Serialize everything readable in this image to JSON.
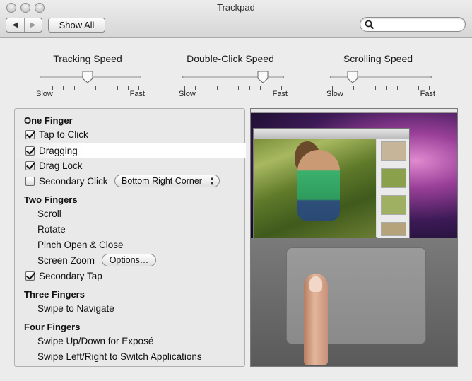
{
  "window": {
    "title": "Trackpad"
  },
  "toolbar": {
    "back_label": "◀",
    "forward_label": "▶",
    "show_all_label": "Show All",
    "search_placeholder": ""
  },
  "sliders": [
    {
      "label": "Tracking Speed",
      "min_label": "Slow",
      "max_label": "Fast",
      "value": 0.45
    },
    {
      "label": "Double-Click Speed",
      "min_label": "Slow",
      "max_label": "Fast",
      "value": 0.78
    },
    {
      "label": "Scrolling Speed",
      "min_label": "Slow",
      "max_label": "Fast",
      "value": 0.25
    }
  ],
  "sections": {
    "one_finger": {
      "title": "One Finger",
      "tap_to_click": {
        "label": "Tap to Click",
        "checked": true
      },
      "dragging": {
        "label": "Dragging",
        "checked": true
      },
      "drag_lock": {
        "label": "Drag Lock",
        "checked": true
      },
      "secondary_click": {
        "label": "Secondary Click",
        "checked": false,
        "popup_value": "Bottom Right Corner"
      }
    },
    "two_fingers": {
      "title": "Two Fingers",
      "scroll": "Scroll",
      "rotate": "Rotate",
      "pinch": "Pinch Open & Close",
      "screen_zoom": "Screen Zoom",
      "options_label": "Options…",
      "secondary_tap": {
        "label": "Secondary Tap",
        "checked": true
      }
    },
    "three_fingers": {
      "title": "Three Fingers",
      "swipe_navigate": "Swipe to Navigate"
    },
    "four_fingers": {
      "title": "Four Fingers",
      "swipe_expose": "Swipe Up/Down for Exposé",
      "swipe_switch": "Swipe Left/Right to Switch Applications"
    }
  },
  "icons": {
    "search": "magnifier-icon",
    "popup_caret": "updown-caret-icon"
  }
}
